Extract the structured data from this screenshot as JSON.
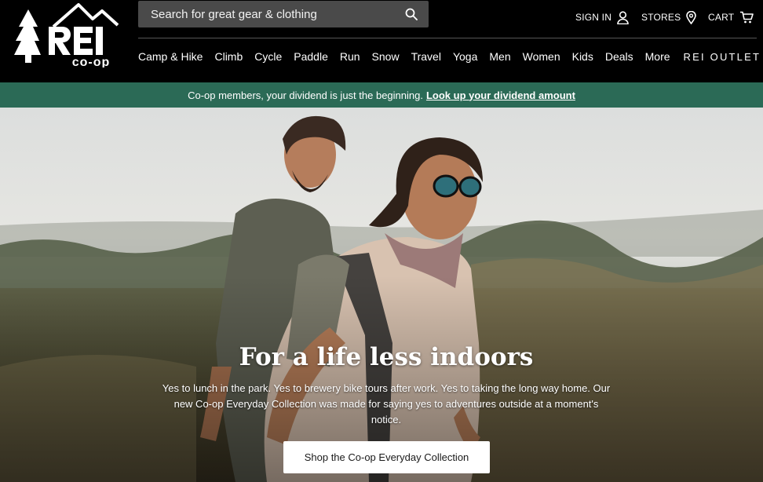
{
  "header": {
    "logo_text": "REI co-op",
    "search": {
      "placeholder": "Search for great gear & clothing"
    },
    "utility": {
      "sign_in": "SIGN IN",
      "stores": "STORES",
      "cart": "CART"
    },
    "nav": {
      "items": [
        "Camp & Hike",
        "Climb",
        "Cycle",
        "Paddle",
        "Run",
        "Snow",
        "Travel",
        "Yoga",
        "Men",
        "Women",
        "Kids",
        "Deals",
        "More"
      ],
      "outlet": "REI OUTLET"
    }
  },
  "promo": {
    "text": "Co-op members, your dividend is just the beginning.",
    "link": "Look up your dividend amount"
  },
  "hero": {
    "title": "For a life less indoors",
    "body": "Yes to lunch in the park. Yes to brewery bike tours after work. Yes to taking the long way home. Our new Co-op Everyday Collection was made for saying yes to adventures outside at a moment's notice.",
    "cta": "Shop the Co-op Everyday Collection"
  },
  "colors": {
    "header_bg": "#000000",
    "promo_bg": "#2b6a56",
    "search_bg": "#4a4a4a",
    "cta_bg": "#ffffff"
  },
  "icons": [
    "search-icon",
    "user-icon",
    "location-pin-icon",
    "cart-icon",
    "chevron-right-icon"
  ]
}
